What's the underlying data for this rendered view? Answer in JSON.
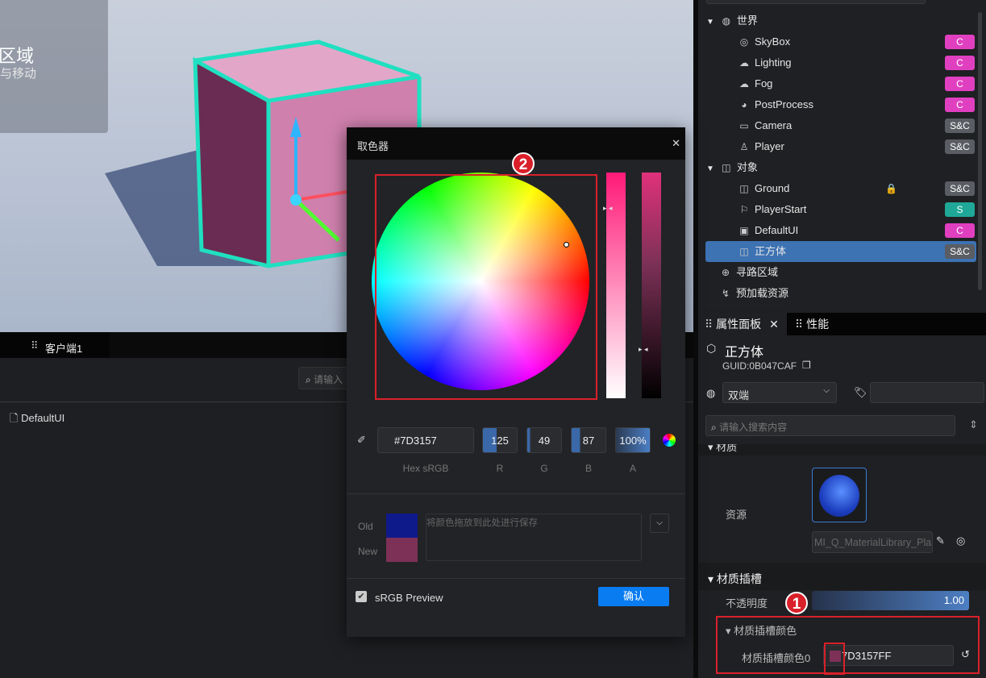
{
  "viewport": {
    "hint_title": "区域",
    "hint_sub": "与移动"
  },
  "bottom": {
    "tab": "客户端1",
    "search_placeholder": "请输入",
    "file": "DefaultUI"
  },
  "tree": {
    "items": [
      {
        "label": "世界",
        "icon": "globe-icon",
        "level": 0
      },
      {
        "label": "SkyBox",
        "icon": "skybox-icon",
        "level": 1,
        "badge": "C"
      },
      {
        "label": "Lighting",
        "icon": "cloud-icon",
        "level": 1,
        "badge": "C"
      },
      {
        "label": "Fog",
        "icon": "fog-icon",
        "level": 1,
        "badge": "C"
      },
      {
        "label": "PostProcess",
        "icon": "palette-icon",
        "level": 1,
        "badge": "C"
      },
      {
        "label": "Camera",
        "icon": "camera-icon",
        "level": 1,
        "badge": "S&C"
      },
      {
        "label": "Player",
        "icon": "player-icon",
        "level": 1,
        "badge": "S&C"
      },
      {
        "label": "对象",
        "icon": "cube-icon",
        "level": 0
      },
      {
        "label": "Ground",
        "icon": "cube-icon",
        "level": 1,
        "badge": "S&C",
        "locked": true
      },
      {
        "label": "PlayerStart",
        "icon": "flag-icon",
        "level": 1,
        "badge": "S"
      },
      {
        "label": "DefaultUI",
        "icon": "ui-icon",
        "level": 1,
        "badge": "C"
      },
      {
        "label": "正方体",
        "icon": "cube-icon",
        "level": 1,
        "badge": "S&C",
        "selected": true
      },
      {
        "label": "寻路区域",
        "icon": "navmesh-icon",
        "level": 0
      },
      {
        "label": "预加载资源",
        "icon": "preload-icon",
        "level": 0
      }
    ],
    "badge_colors": {
      "C": "#e040c0",
      "S&C": "#5a5d63",
      "S": "#1fa898"
    }
  },
  "props": {
    "tab1": "属性面板",
    "tab2": "性能",
    "name": "正方体",
    "guid": "GUID:0B047CAF",
    "net": "双端",
    "search_placeholder": "请输入搜索内容",
    "material_section": "材质",
    "resource_label": "资源",
    "resource_name": "MI_Q_MaterialLibrary_Pla",
    "slot_section": "材质插槽",
    "opacity_label": "不透明度",
    "opacity_value": "1.00",
    "color_group": "材质插槽颜色",
    "color_label": "材质插槽颜色0",
    "color_value": "7D3157FF"
  },
  "picker": {
    "title": "取色器",
    "hex": "#7D3157",
    "r": "125",
    "g": "49",
    "b": "87",
    "a": "100%",
    "hex_label": "Hex sRGB",
    "r_label": "R",
    "g_label": "G",
    "b_label": "B",
    "a_label": "A",
    "old_label": "Old",
    "new_label": "New",
    "old_color": "#0f1a8a",
    "new_color": "#7D3157",
    "save_placeholder": "将颜色拖放到此处进行保存",
    "srgb_preview": "sRGB Preview",
    "confirm": "确认"
  },
  "markers": {
    "m1": "1",
    "m2": "2"
  }
}
